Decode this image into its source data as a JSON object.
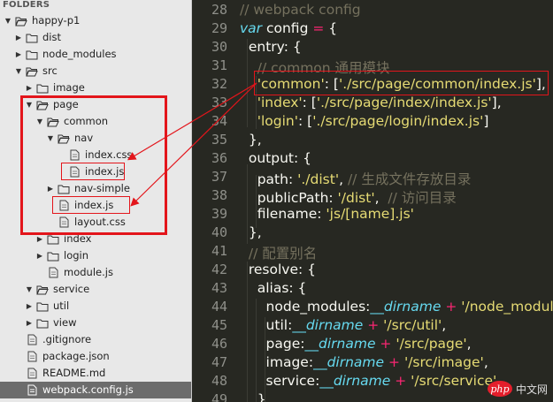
{
  "sidebar": {
    "header": "FOLDERS",
    "tree": [
      {
        "label": "happy-p1",
        "type": "folder",
        "open": true,
        "depth": 0
      },
      {
        "label": "dist",
        "type": "folder",
        "open": false,
        "depth": 1
      },
      {
        "label": "node_modules",
        "type": "folder",
        "open": false,
        "depth": 1
      },
      {
        "label": "src",
        "type": "folder",
        "open": true,
        "depth": 1
      },
      {
        "label": "image",
        "type": "folder",
        "open": false,
        "depth": 2
      },
      {
        "label": "page",
        "type": "folder",
        "open": true,
        "depth": 2
      },
      {
        "label": "common",
        "type": "folder",
        "open": true,
        "depth": 3
      },
      {
        "label": "nav",
        "type": "folder",
        "open": true,
        "depth": 4
      },
      {
        "label": "index.css",
        "type": "file",
        "depth": 5
      },
      {
        "label": "index.js",
        "type": "file",
        "depth": 5
      },
      {
        "label": "nav-simple",
        "type": "folder",
        "open": false,
        "depth": 4
      },
      {
        "label": "index.js",
        "type": "file",
        "depth": 4
      },
      {
        "label": "layout.css",
        "type": "file",
        "depth": 4
      },
      {
        "label": "index",
        "type": "folder",
        "open": false,
        "depth": 3
      },
      {
        "label": "login",
        "type": "folder",
        "open": false,
        "depth": 3
      },
      {
        "label": "module.js",
        "type": "file",
        "depth": 3
      },
      {
        "label": "service",
        "type": "folder",
        "open": true,
        "depth": 2
      },
      {
        "label": "util",
        "type": "folder",
        "open": false,
        "depth": 2
      },
      {
        "label": "view",
        "type": "folder",
        "open": false,
        "depth": 2
      },
      {
        "label": ".gitignore",
        "type": "file",
        "depth": 1
      },
      {
        "label": "package.json",
        "type": "file",
        "depth": 1
      },
      {
        "label": "README.md",
        "type": "file",
        "depth": 1
      },
      {
        "label": "webpack.config.js",
        "type": "file",
        "depth": 1,
        "selected": true
      }
    ]
  },
  "editor": {
    "lines": [
      {
        "n": "28",
        "code": "<span class='cm'>// webpack config</span>"
      },
      {
        "n": "29",
        "code": "<span class='kw'>var</span> config <span class='op'>=</span> {"
      },
      {
        "n": "30",
        "code": "  entry: {"
      },
      {
        "n": "31",
        "code": "    <span class='cm'>// common 通用模块</span>"
      },
      {
        "n": "32",
        "code": "    <span class='str'>'common'</span>: [<span class='str'>'./src/page/common/index.js'</span>],"
      },
      {
        "n": "33",
        "code": "    <span class='str'>'index'</span>: [<span class='str'>'./src/page/index/index.js'</span>],"
      },
      {
        "n": "34",
        "code": "    <span class='str'>'login'</span>: [<span class='str'>'./src/page/login/index.js'</span>]"
      },
      {
        "n": "35",
        "code": "  },"
      },
      {
        "n": "36",
        "code": "  output: {"
      },
      {
        "n": "37",
        "code": "    path: <span class='str'>'./dist'</span>, <span class='cm'>// 生成文件存放目录</span>"
      },
      {
        "n": "38",
        "code": "    publicPath: <span class='str'>'/dist'</span>,  <span class='cm'>// 访问目录</span>"
      },
      {
        "n": "39",
        "code": "    filename: <span class='str'>'js/[name].js'</span>"
      },
      {
        "n": "40",
        "code": "  },"
      },
      {
        "n": "41",
        "code": "  <span class='cm'>// 配置别名</span>"
      },
      {
        "n": "42",
        "code": "  resolve: {"
      },
      {
        "n": "43",
        "code": "    alias: {"
      },
      {
        "n": "44",
        "code": "      node_modules:<span class='kw'>__dirname</span> <span class='op'>+</span> <span class='str'>'/node_modules'</span>,"
      },
      {
        "n": "45",
        "code": "      util:<span class='kw'>__dirname</span> <span class='op'>+</span> <span class='str'>'/src/util'</span>,"
      },
      {
        "n": "46",
        "code": "      page:<span class='kw'>__dirname</span> <span class='op'>+</span> <span class='str'>'/src/page'</span>,"
      },
      {
        "n": "47",
        "code": "      image:<span class='kw'>__dirname</span> <span class='op'>+</span> <span class='str'>'/src/image'</span>,"
      },
      {
        "n": "48",
        "code": "      service:<span class='kw'>__dirname</span> <span class='op'>+</span> <span class='str'>'/src/service'</span>"
      },
      {
        "n": "49",
        "code": "    }"
      }
    ]
  },
  "watermark": {
    "logo": "php",
    "text": "中文网"
  },
  "colors": {
    "sidebar_bg": "#e8e8e8",
    "editor_bg": "#272822",
    "highlight": "#e3151b",
    "selected_row": "#6c6c6c"
  }
}
